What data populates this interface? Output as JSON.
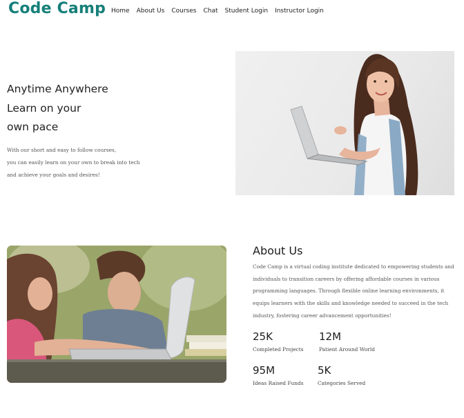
{
  "header": {
    "brand": "Code Camp",
    "nav": [
      {
        "label": "Home"
      },
      {
        "label": "About Us"
      },
      {
        "label": "Courses"
      },
      {
        "label": "Chat"
      },
      {
        "label": "Student Login"
      },
      {
        "label": "Instructor Login"
      }
    ]
  },
  "hero": {
    "title_lines": [
      "Anytime Anywhere",
      "Learn on your",
      "own pace"
    ],
    "text_lines": [
      "With our short and easy to follow courses,",
      "you can easily learn on your own to break into tech",
      "and achieve your goals and desires!"
    ],
    "image": "woman-with-laptop-photo"
  },
  "about": {
    "image": "students-with-laptop-photo",
    "title": "About Us",
    "text_lines": [
      "Code Camp is a virtual coding institute dedicated to empowering students and",
      "individuals to transition careers by offering affordable courses in various",
      "programming languages. Through flexible online learning environments, it",
      "equips learners with the skills and knowledge needed to succeed in the tech",
      "industry, fostering career advancement opportunities!"
    ],
    "stats": [
      {
        "value": "25K",
        "label": "Completed Projects"
      },
      {
        "value": "12M",
        "label": "Patient Around World"
      },
      {
        "value": "95M",
        "label": "Ideas Raised Funds"
      },
      {
        "value": "5K",
        "label": "Categories Served"
      }
    ]
  }
}
